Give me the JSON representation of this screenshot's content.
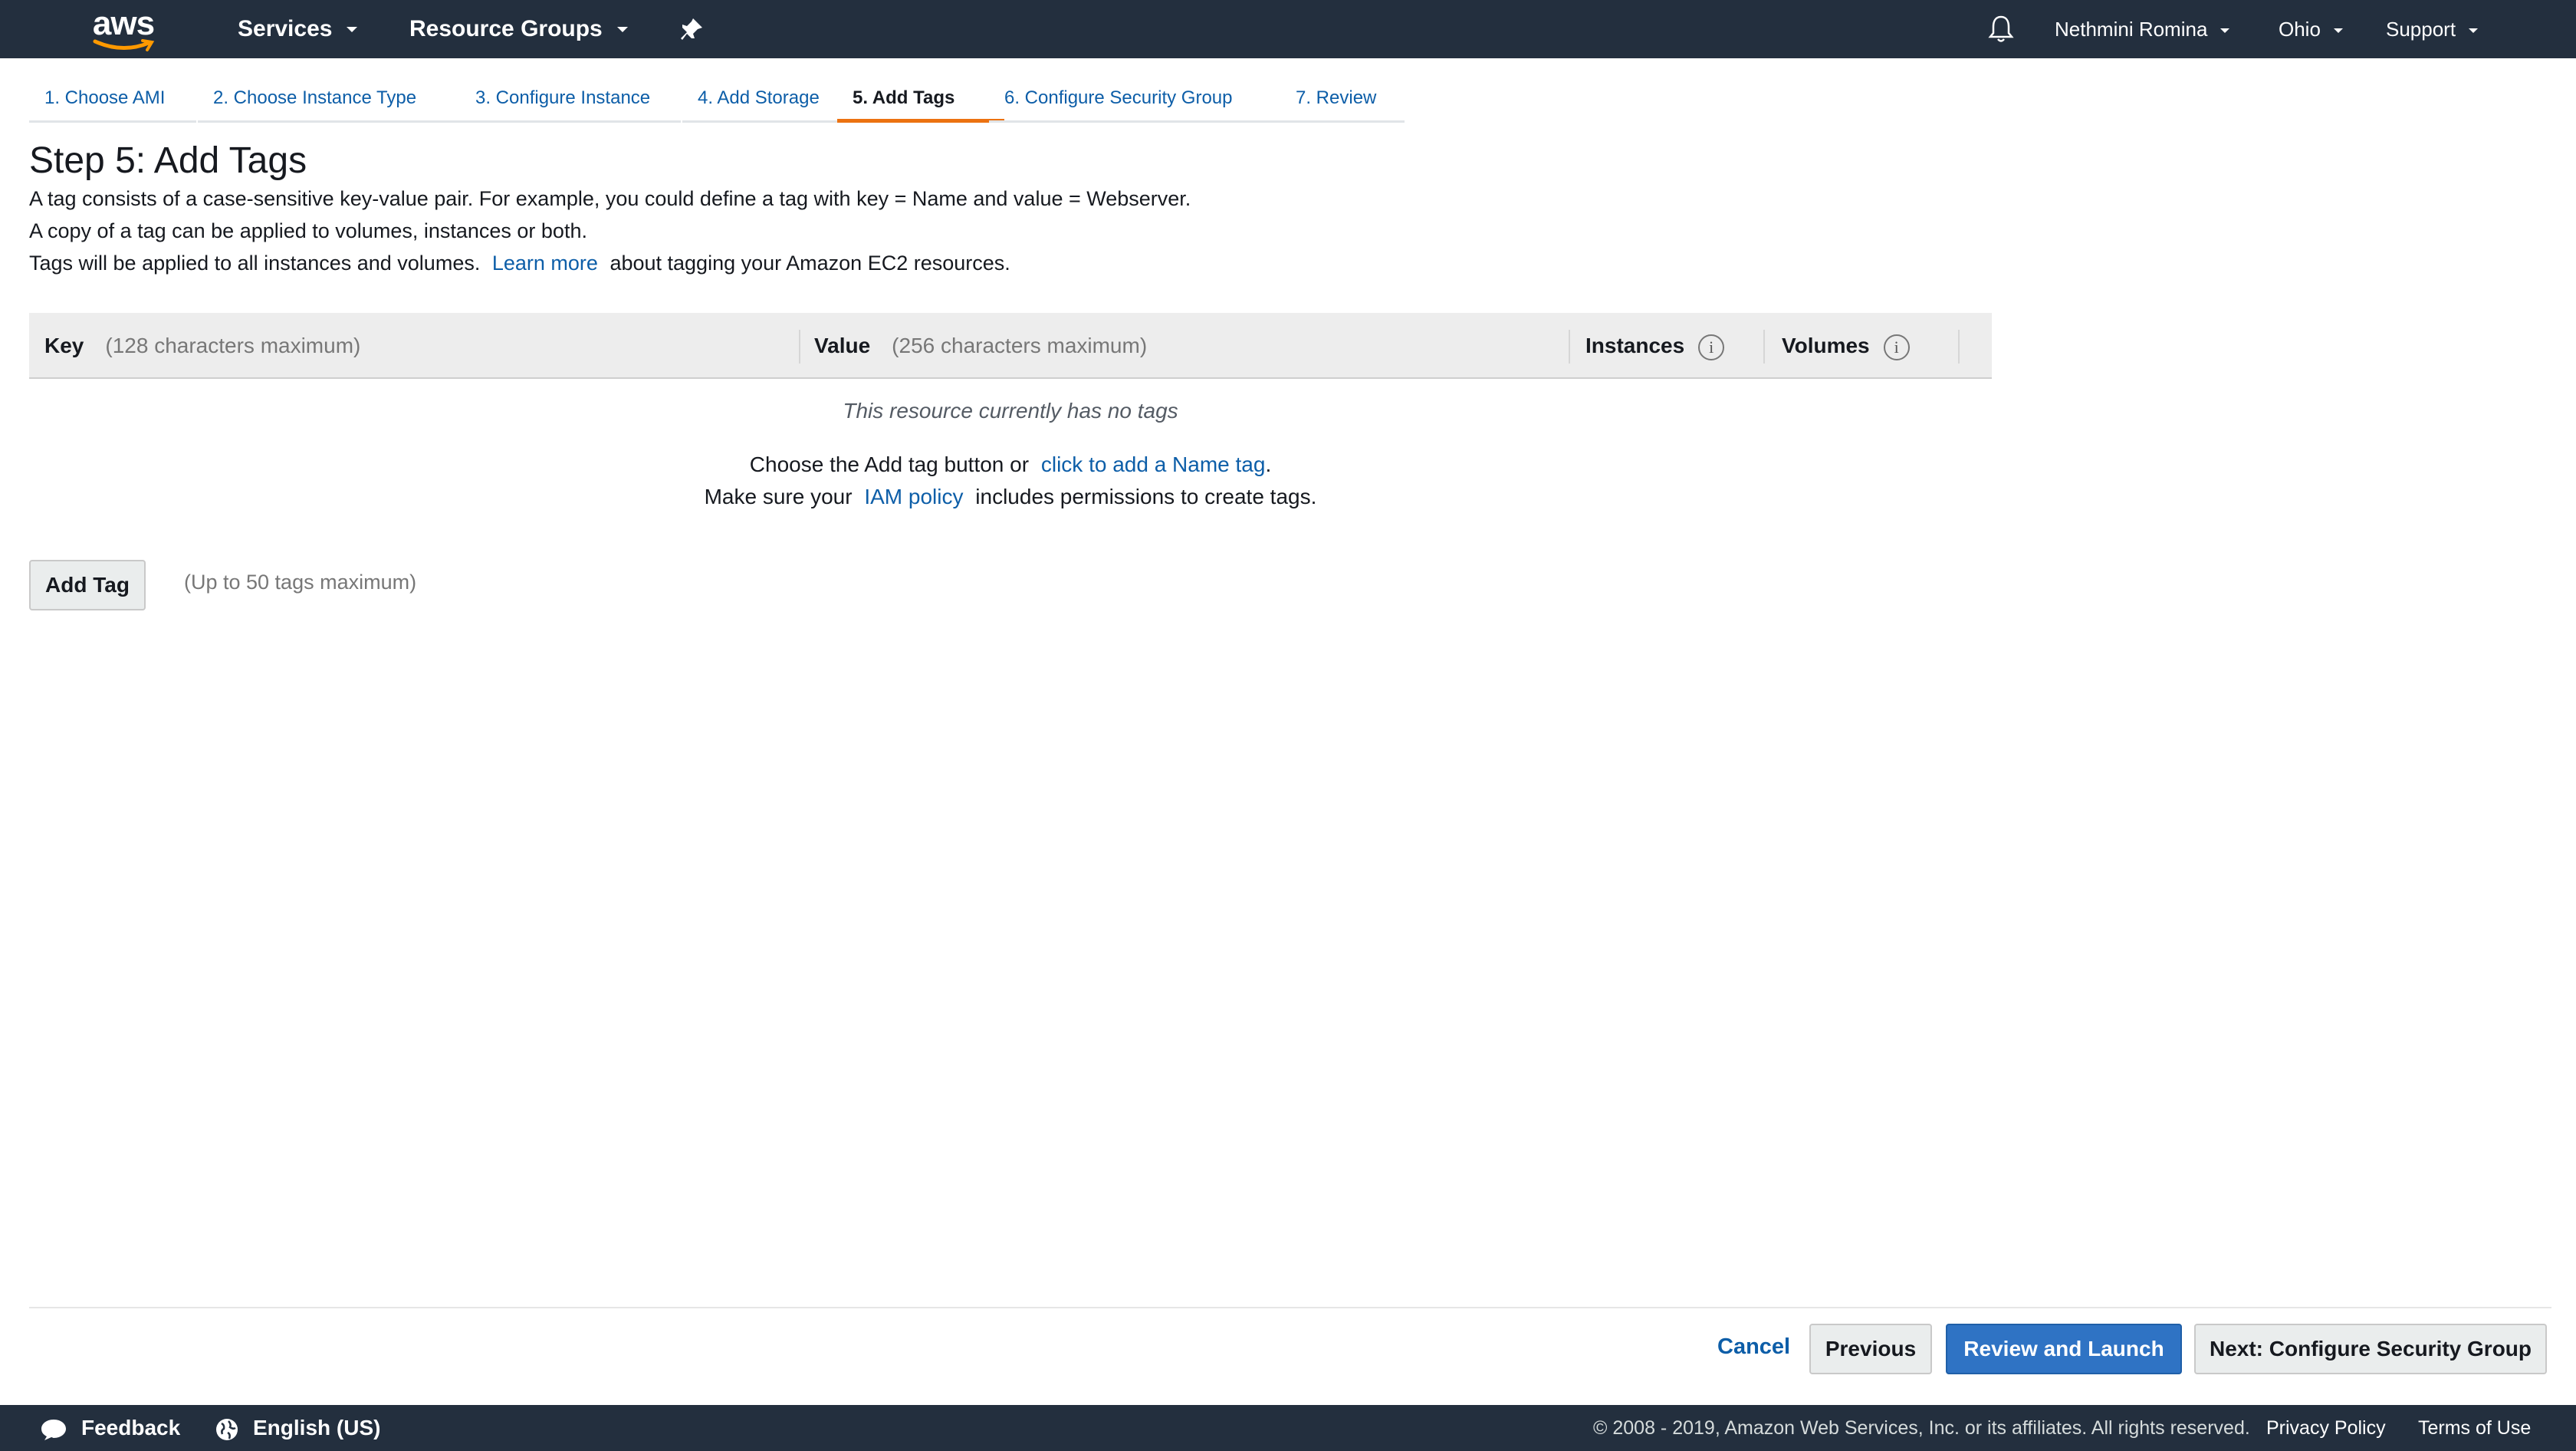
{
  "topnav": {
    "logo_text": "aws",
    "services": "Services",
    "resource_groups": "Resource Groups",
    "user": "Nethmini Romina",
    "region": "Ohio",
    "support": "Support"
  },
  "tabs": [
    {
      "label": "1. Choose AMI"
    },
    {
      "label": "2. Choose Instance Type"
    },
    {
      "label": "3. Configure Instance"
    },
    {
      "label": "4. Add Storage"
    },
    {
      "label": "5. Add Tags"
    },
    {
      "label": "6. Configure Security Group"
    },
    {
      "label": "7. Review"
    }
  ],
  "page": {
    "title": "Step 5: Add Tags",
    "line1": "A tag consists of a case-sensitive key-value pair. For example, you could define a tag with key = Name and value = Webserver.",
    "line2": "A copy of a tag can be applied to volumes, instances or both.",
    "line3_before": "Tags will be applied to all instances and volumes.",
    "learn_more": "Learn more",
    "line3_after": "about tagging your Amazon EC2 resources."
  },
  "table": {
    "key_label": "Key",
    "key_hint": "(128 characters maximum)",
    "value_label": "Value",
    "value_hint": "(256 characters maximum)",
    "instances_label": "Instances",
    "volumes_label": "Volumes",
    "empty_message": "This resource currently has no tags",
    "hint1_before": "Choose the Add tag button or",
    "hint1_link": "click to add a Name tag",
    "hint1_after": ".",
    "hint2_before": "Make sure your",
    "hint2_link": "IAM policy",
    "hint2_after": "includes permissions to create tags."
  },
  "add_tag": {
    "button": "Add Tag",
    "note": "(Up to 50 tags maximum)"
  },
  "actions": {
    "cancel": "Cancel",
    "previous": "Previous",
    "review_launch": "Review and Launch",
    "next": "Next: Configure Security Group"
  },
  "footer": {
    "feedback": "Feedback",
    "language": "English (US)",
    "copyright": "© 2008 - 2019, Amazon Web Services, Inc. or its affiliates. All rights reserved.",
    "privacy": "Privacy Policy",
    "terms": "Terms of Use"
  },
  "colors": {
    "nav_bg": "#232f3e",
    "link": "#0d5ea8",
    "active_tab": "#ec7211",
    "primary_button": "#2f73c4"
  }
}
